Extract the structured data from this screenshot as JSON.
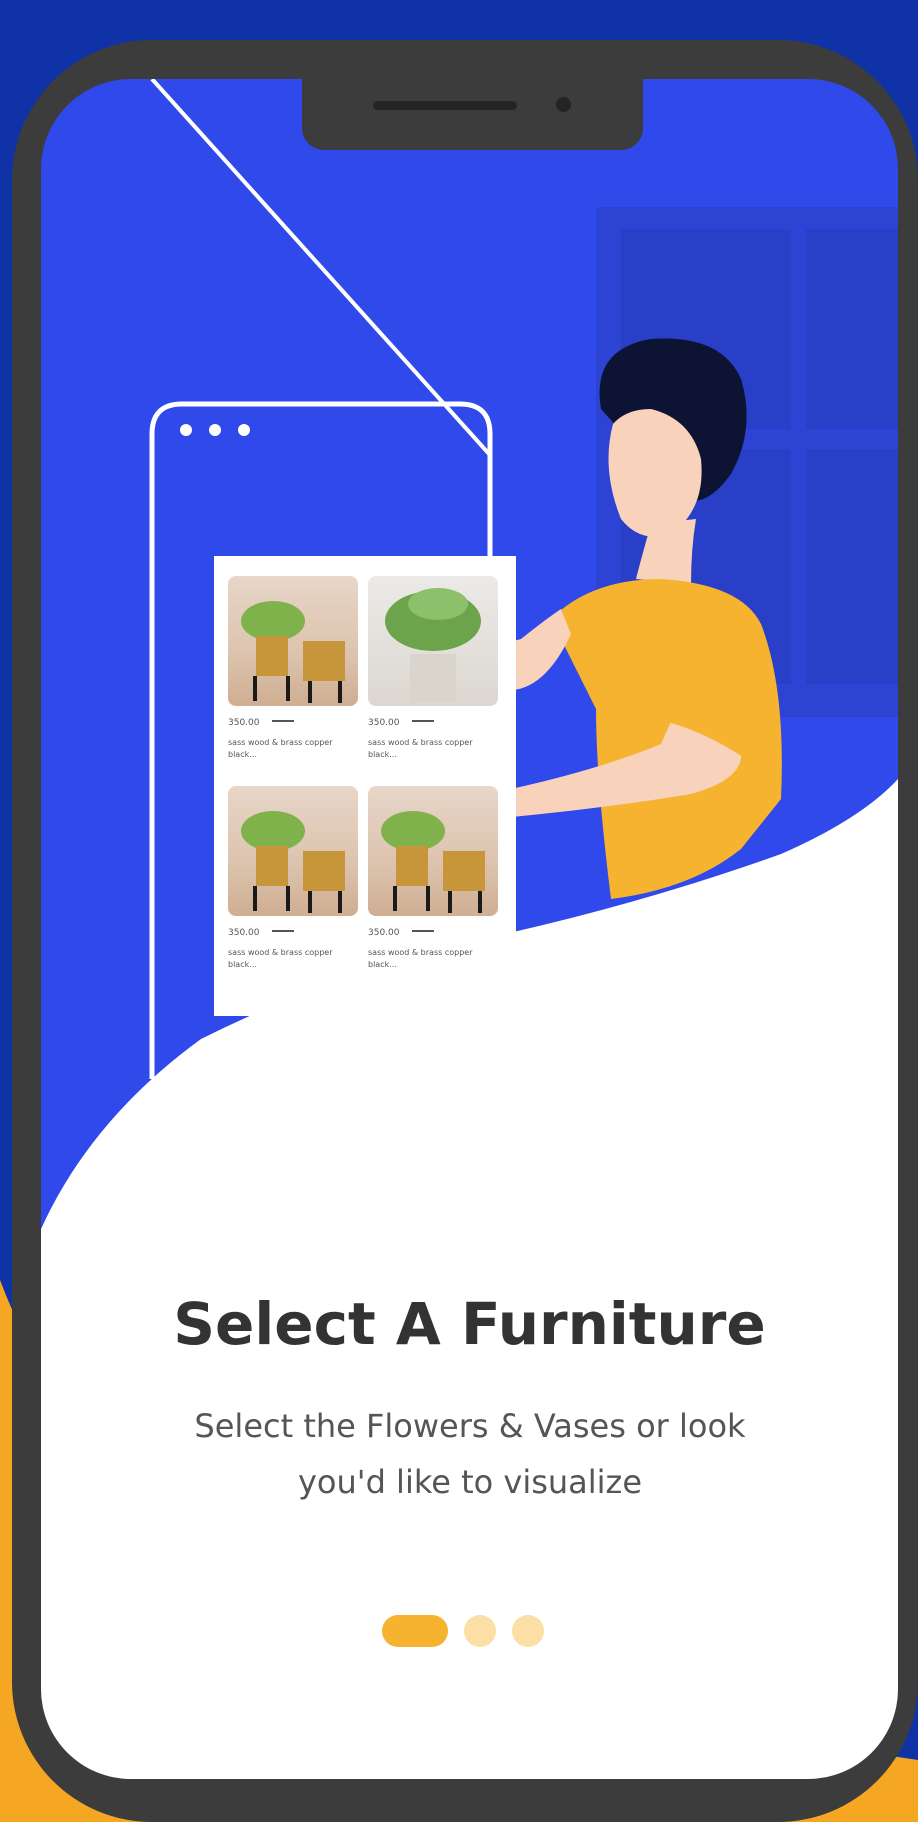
{
  "onboarding": {
    "title": "Select A Furniture",
    "subtitle": "Select the Flowers & Vases or look you'd like to visualize",
    "pager": {
      "total": 3,
      "active_index": 0
    }
  },
  "illustration": {
    "products": [
      {
        "price": "350.00",
        "description": "sass wood & brass copper black..."
      },
      {
        "price": "350.00",
        "description": "sass wood & brass copper black..."
      },
      {
        "price": "350.00",
        "description": "sass wood & brass copper black..."
      },
      {
        "price": "350.00",
        "description": "sass wood & brass copper black..."
      }
    ]
  },
  "colors": {
    "brand_blue": "#2f49ea",
    "accent_yellow": "#f5b32f",
    "frame_dark": "#3c3c3c"
  }
}
